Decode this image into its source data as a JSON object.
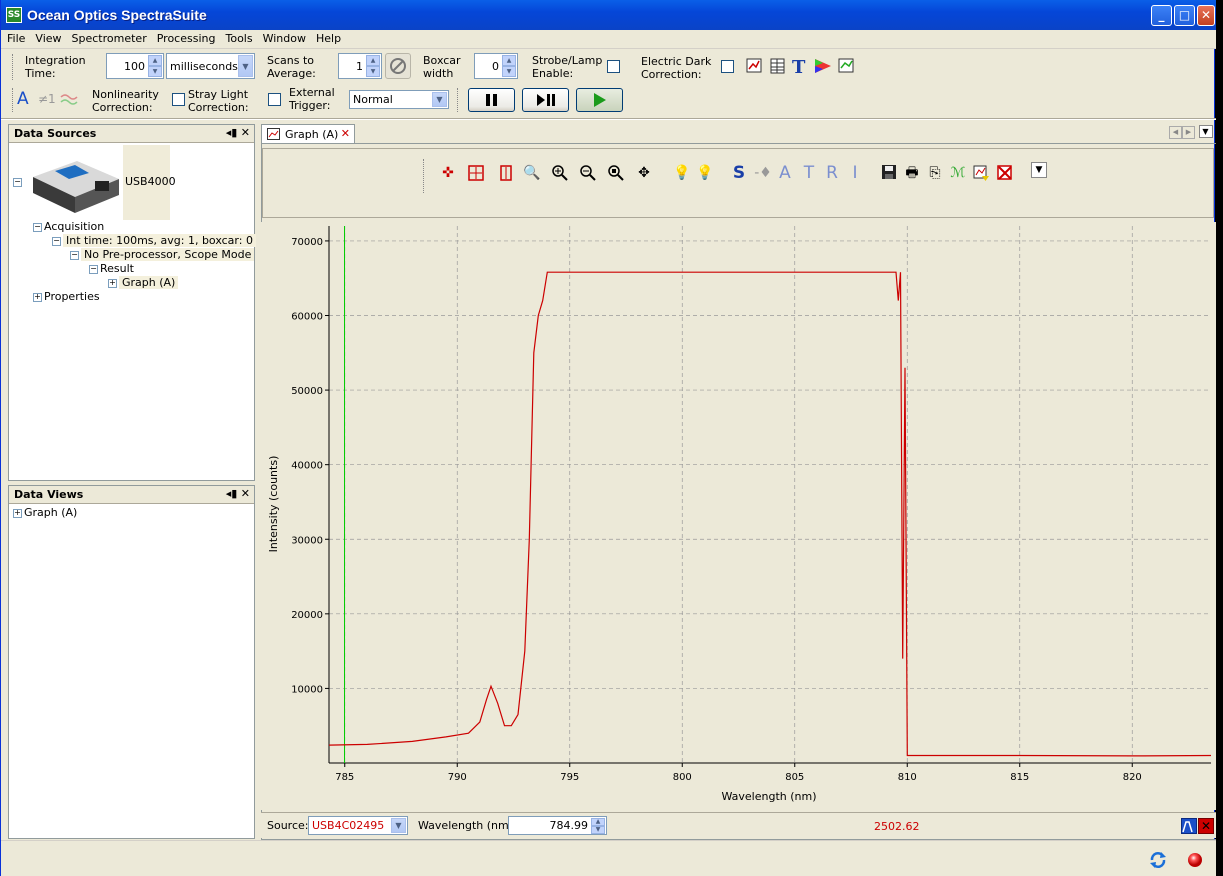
{
  "window": {
    "title": "Ocean Optics SpectraSuite",
    "icon_label": "SS"
  },
  "menu": [
    "File",
    "View",
    "Spectrometer",
    "Processing",
    "Tools",
    "Window",
    "Help"
  ],
  "toolbar": {
    "integration_label_1": "Integration",
    "integration_label_2": "Time:",
    "integration_value": "100",
    "integration_unit": "milliseconds",
    "scans_label_1": "Scans to",
    "scans_label_2": "Average:",
    "scans_value": "1",
    "boxcar_label_1": "Boxcar",
    "boxcar_label_2": "width",
    "boxcar_value": "0",
    "strobe_label_1": "Strobe/Lamp",
    "strobe_label_2": "Enable:",
    "dark_label_1": "Electric Dark",
    "dark_label_2": "Correction:",
    "nonlin_label_1": "Nonlinearity",
    "nonlin_label_2": "Correction:",
    "stray_label_1": "Stray Light",
    "stray_label_2": "Correction:",
    "trigger_label_1": "External",
    "trigger_label_2": "Trigger:",
    "trigger_mode": "Normal",
    "icon_A": "A",
    "icon_ne1": "≠1"
  },
  "data_sources": {
    "title": "Data Sources",
    "device": "USB4000",
    "acquisition": "Acquisition",
    "int_time": "Int time: 100ms, avg: 1, boxcar: 0",
    "preproc": "No Pre-processor, Scope Mode",
    "result": "Result",
    "graph": "Graph (A)",
    "properties": "Properties"
  },
  "data_views": {
    "title": "Data Views",
    "graph": "Graph (A)"
  },
  "tab": {
    "label": "Graph (A)"
  },
  "graph_toolbar": {
    "letters": [
      "S",
      "A",
      "T",
      "R",
      "I"
    ]
  },
  "chart_data": {
    "type": "line",
    "xlabel": "Wavelength (nm)",
    "ylabel": "Intensity (counts)",
    "xlim": [
      784.3,
      823.5
    ],
    "ylim": [
      0,
      72000
    ],
    "xticks": [
      785,
      790,
      795,
      800,
      805,
      810,
      815,
      820
    ],
    "yticks": [
      10000,
      20000,
      30000,
      40000,
      50000,
      60000,
      70000
    ],
    "grid": true,
    "line_color": "#cc0000",
    "cursor_color": "#00cc00",
    "cursor_x": 784.99,
    "series": [
      {
        "x": [
          784.3,
          786,
          788,
          789.5,
          790.5,
          791,
          791.3,
          791.5,
          791.8,
          792.1,
          792.4,
          792.7,
          793.0,
          793.2,
          793.4,
          793.6,
          793.8,
          794.0,
          809.5,
          809.6,
          809.7,
          809.8,
          809.9,
          810.0,
          815,
          820,
          823.5
        ],
        "y": [
          2400,
          2500,
          2900,
          3500,
          4000,
          5500,
          8500,
          10300,
          8000,
          5000,
          5000,
          6500,
          15000,
          30000,
          55000,
          60000,
          62000,
          65800,
          65800,
          62000,
          65800,
          14000,
          53000,
          1000,
          1000,
          950,
          1000
        ]
      }
    ]
  },
  "status": {
    "source_label": "Source:",
    "source_value": "USB4C02495",
    "wavelength_label": "Wavelength (nm):",
    "wavelength_value": "784.99",
    "intensity_readout": "2502.62"
  }
}
